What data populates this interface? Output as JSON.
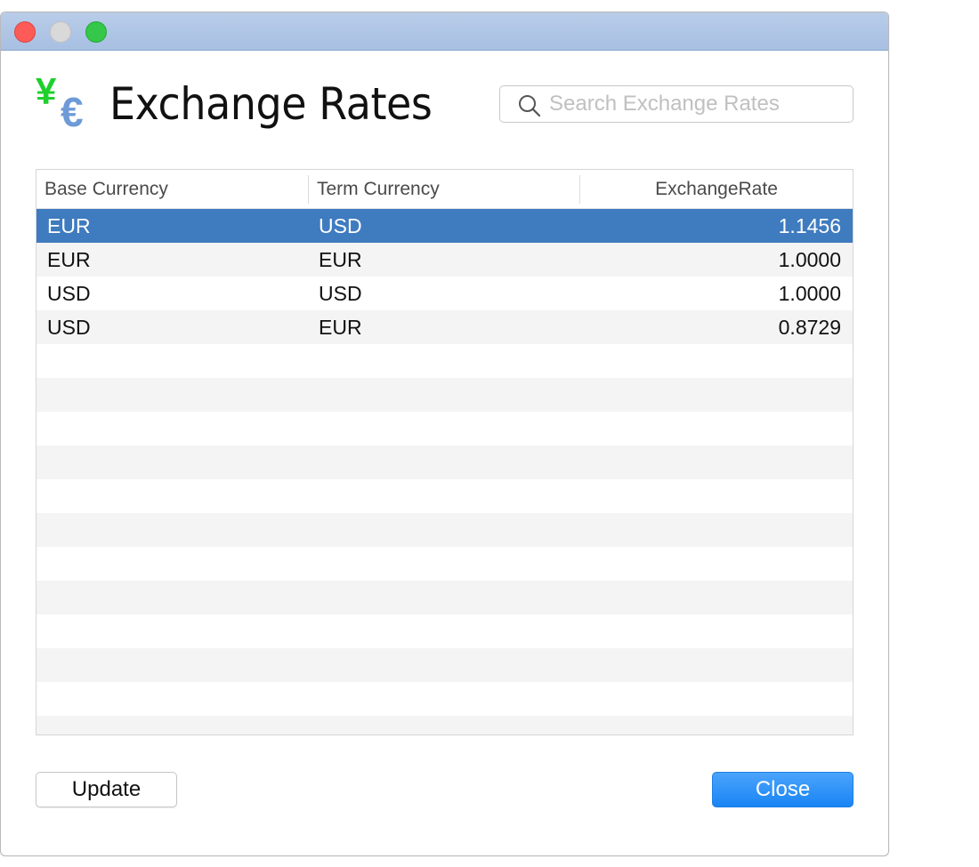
{
  "window": {
    "traffic_lights": [
      "close",
      "minimize",
      "zoom"
    ]
  },
  "header": {
    "icon": "yen-euro-icon",
    "title": "Exchange Rates",
    "search": {
      "placeholder": "Search Exchange Rates",
      "value": ""
    }
  },
  "table": {
    "columns": [
      "Base Currency",
      "Term Currency",
      "ExchangeRate"
    ],
    "rows": [
      {
        "base": "EUR",
        "term": "USD",
        "rate": "1.1456",
        "selected": true
      },
      {
        "base": "EUR",
        "term": "EUR",
        "rate": "1.0000",
        "selected": false
      },
      {
        "base": "USD",
        "term": "USD",
        "rate": "1.0000",
        "selected": false
      },
      {
        "base": "USD",
        "term": "EUR",
        "rate": "0.8729",
        "selected": false
      }
    ]
  },
  "buttons": {
    "update_label": "Update",
    "close_label": "Close"
  },
  "colors": {
    "selection": "#3f7bbf",
    "primary_button": "#1a84f5",
    "titlebar": "#b9cde9",
    "yen_icon": "#1fd02c",
    "euro_icon": "#6e9bd8"
  }
}
